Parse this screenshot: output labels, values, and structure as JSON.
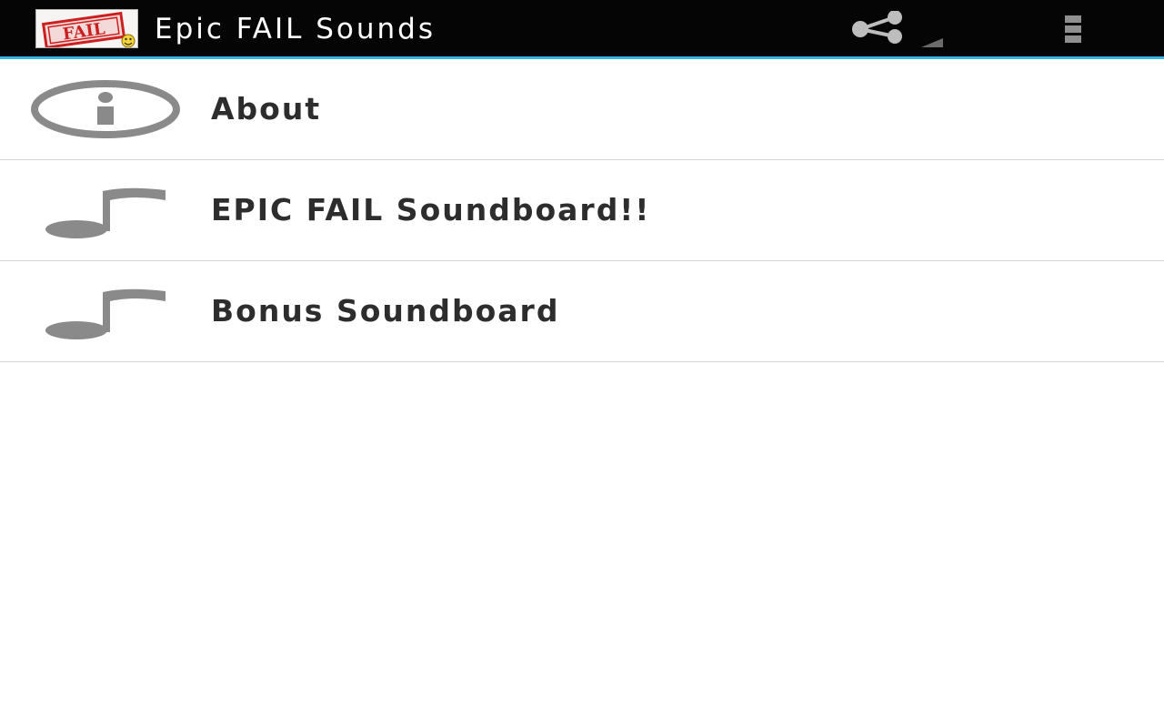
{
  "action_bar": {
    "title": "Epic FAIL Sounds",
    "logo_text": "FAIL",
    "app_icon": "fail-stamp-icon",
    "share_icon": "share-icon",
    "overflow_icon": "overflow-menu-icon",
    "background_color": "#050505",
    "accent_color": "#33b5e5"
  },
  "menu": {
    "items": [
      {
        "label": "About",
        "icon": "info-icon"
      },
      {
        "label": "EPIC FAIL Soundboard!!",
        "icon": "music-note-icon"
      },
      {
        "label": "Bonus Soundboard",
        "icon": "music-note-icon"
      }
    ],
    "icon_color": "#8a8a8a",
    "text_color": "#2d2d2d"
  }
}
